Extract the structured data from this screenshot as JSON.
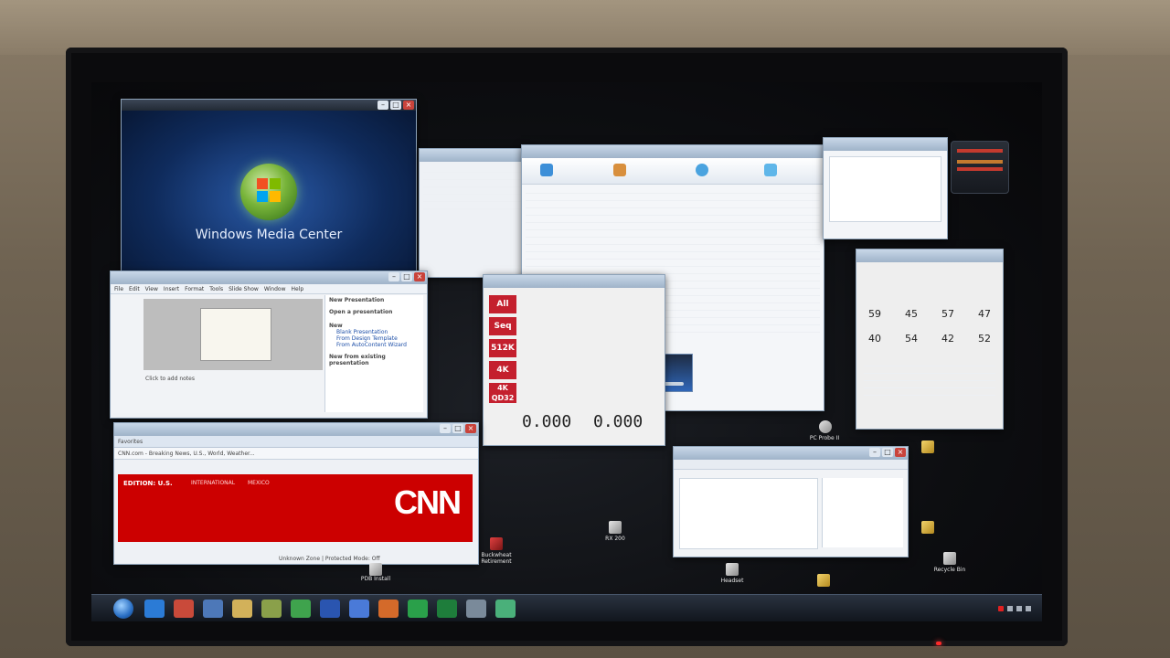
{
  "wmc": {
    "title": "Windows Media Center"
  },
  "slides": {
    "menu": [
      "File",
      "Edit",
      "View",
      "Insert",
      "Format",
      "Tools",
      "Slide Show",
      "Window",
      "Help"
    ],
    "panel_title": "New Presentation",
    "open_heading": "Open a presentation",
    "new_heading": "New",
    "new_items": [
      "Blank Presentation",
      "From Design Template",
      "From AutoContent Wizard"
    ],
    "existing_heading": "New from existing presentation",
    "notes_placeholder": "Click to add notes"
  },
  "cdm": {
    "labels": [
      "All",
      "Seq",
      "512K",
      "4K",
      "4K QD32"
    ],
    "read_value": "0.000",
    "write_value": "0.000"
  },
  "browser": {
    "favorites": "Favorites",
    "tab_label": "CNN.com - Breaking News, U.S., World, Weather...",
    "edition": "EDITION: U.S.",
    "edition_links": [
      "INTERNATIONAL",
      "MEXICO"
    ],
    "logo": "CNN",
    "status": "Unknown Zone | Protected Mode: Off"
  },
  "coretemp": {
    "readings_row1": [
      "59",
      "45",
      "57",
      "47"
    ],
    "readings_row2": [
      "40",
      "54",
      "42",
      "52"
    ]
  },
  "desktop_icons": [
    "PC Probe II",
    "PDB Install",
    "Buckwheat Retirement",
    "Recycle Bin",
    "Headset",
    "RX 200"
  ],
  "taskbar": {
    "time": "",
    "apps": [
      "ie",
      "explorer",
      "wmc",
      "folder",
      "media",
      "cpuz",
      "word",
      "messenger",
      "office",
      "xls",
      "excel",
      "cdm",
      "monitor"
    ]
  },
  "colors": {
    "cnn_red": "#cc0000",
    "wmc_blue": "#0f2b5c",
    "cdm_red": "#c4202e",
    "aero_title": "#9fb3c9"
  }
}
